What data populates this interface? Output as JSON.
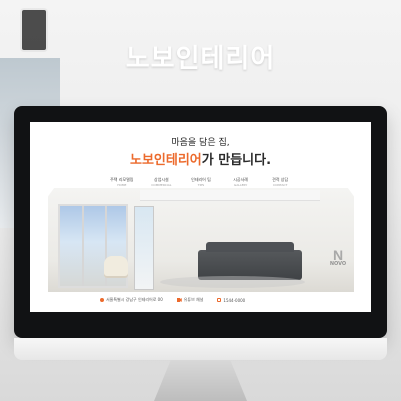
{
  "brand": {
    "title": "노보인테리어"
  },
  "monitor": {
    "headline": "마음을 담은 집,",
    "brand_prefix": "노보인테리어",
    "brand_suffix": "가 만듭니다."
  },
  "nav": [
    {
      "main": "주택 리모델링",
      "sub": "HOME"
    },
    {
      "main": "상업시설",
      "sub": "COMMERCIAL"
    },
    {
      "main": "인테리어 팁",
      "sub": "TIPS"
    },
    {
      "main": "시공사례",
      "sub": "GALLERY"
    },
    {
      "main": "견적 상담",
      "sub": "CONTACT"
    }
  ],
  "footer": {
    "address": "서울특별시 강남구 인테리어로 00",
    "video": "유튜브 채널",
    "phone": "1544-0000"
  },
  "logo": {
    "mark": "N",
    "text": "NOVO"
  }
}
